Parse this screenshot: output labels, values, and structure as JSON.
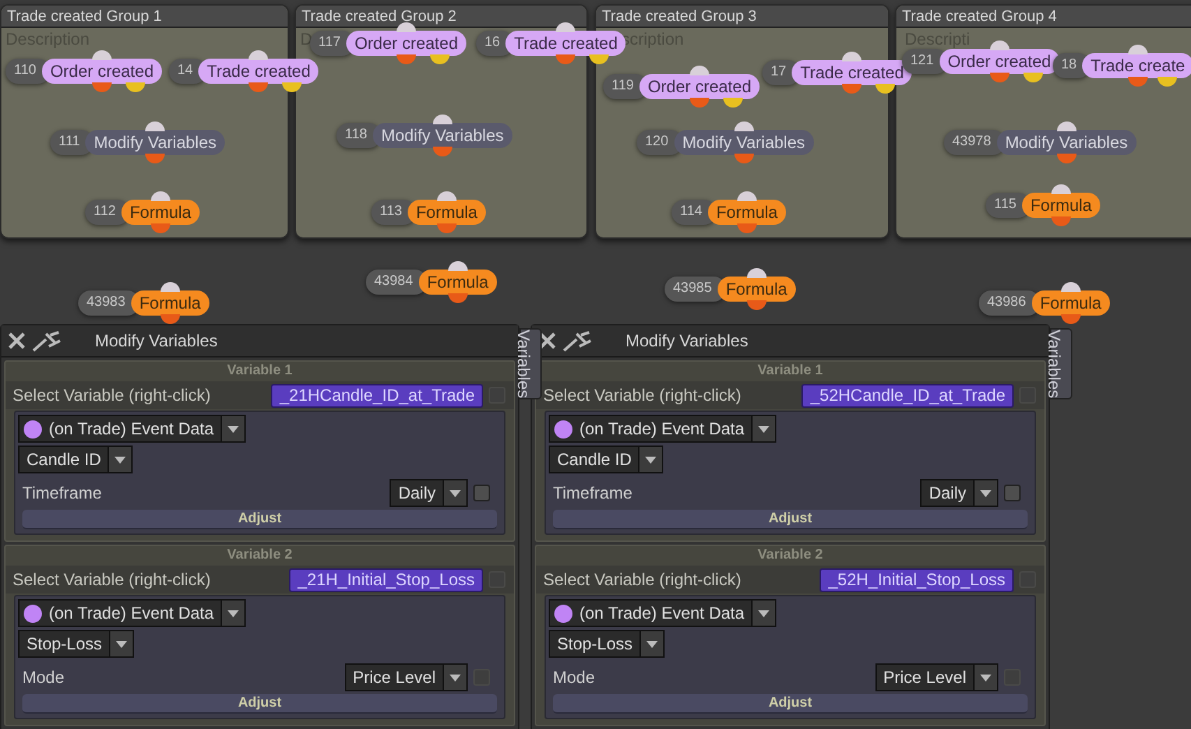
{
  "groups": [
    {
      "title": "Trade created Group 1",
      "description": "Description",
      "nodes": [
        {
          "kind": "event",
          "id": "110",
          "label": "Order created"
        },
        {
          "kind": "event",
          "id": "14",
          "label": "Trade created"
        },
        {
          "kind": "modify",
          "id": "111",
          "label": "Modify Variables"
        },
        {
          "kind": "formula",
          "id": "112",
          "label": "Formula"
        }
      ]
    },
    {
      "title": "Trade created Group 2",
      "description": "D",
      "nodes": [
        {
          "kind": "event",
          "id": "117",
          "label": "Order created"
        },
        {
          "kind": "event",
          "id": "16",
          "label": "Trade created"
        },
        {
          "kind": "modify",
          "id": "118",
          "label": "Modify Variables"
        },
        {
          "kind": "formula",
          "id": "113",
          "label": "Formula"
        }
      ]
    },
    {
      "title": "Trade created Group 3",
      "description": "scription",
      "nodes": [
        {
          "kind": "event",
          "id": "119",
          "label": "Order created"
        },
        {
          "kind": "event",
          "id": "17",
          "label": "Trade created"
        },
        {
          "kind": "modify",
          "id": "120",
          "label": "Modify Variables"
        },
        {
          "kind": "formula",
          "id": "114",
          "label": "Formula"
        }
      ]
    },
    {
      "title": "Trade created Group 4",
      "description": "Descripti",
      "nodes": [
        {
          "kind": "event",
          "id": "121",
          "label": "Order created"
        },
        {
          "kind": "event",
          "id": "18",
          "label": "Trade create"
        },
        {
          "kind": "modify",
          "id": "43978",
          "label": "Modify Variables"
        },
        {
          "kind": "formula",
          "id": "115",
          "label": "Formula"
        }
      ]
    }
  ],
  "outside_nodes": [
    {
      "kind": "formula",
      "id": "43983",
      "label": "Formula"
    },
    {
      "kind": "formula",
      "id": "43984",
      "label": "Formula"
    },
    {
      "kind": "formula",
      "id": "43985",
      "label": "Formula"
    },
    {
      "kind": "formula",
      "id": "43986",
      "label": "Formula"
    }
  ],
  "panels": [
    {
      "title": "Modify Variables",
      "side_tab": "Variables",
      "variables": [
        {
          "heading": "Variable 1",
          "select_label": "Select Variable (right-click)",
          "variable": "_21HCandle_ID_at_Trade",
          "select_checkbox": {
            "checked": false,
            "disabled": true
          },
          "source": "(on Trade) Event Data",
          "field": "Candle ID",
          "param_label": "Timeframe",
          "param_value": "Daily",
          "param_checkbox": {
            "checked": false,
            "disabled": false
          },
          "button": "Adjust"
        },
        {
          "heading": "Variable 2",
          "select_label": "Select Variable (right-click)",
          "variable": "_21H_Initial_Stop_Loss",
          "select_checkbox": {
            "checked": false,
            "disabled": true
          },
          "source": "(on Trade) Event Data",
          "field": "Stop-Loss",
          "param_label": "Mode",
          "param_value": "Price Level",
          "param_checkbox": {
            "checked": false,
            "disabled": true
          },
          "button": "Adjust"
        }
      ]
    },
    {
      "title": "Modify Variables",
      "side_tab": "Variables",
      "variables": [
        {
          "heading": "Variable 1",
          "select_label": "Select Variable (right-click)",
          "variable": "_52HCandle_ID_at_Trade",
          "select_checkbox": {
            "checked": false,
            "disabled": true
          },
          "source": "(on Trade) Event Data",
          "field": "Candle ID",
          "param_label": "Timeframe",
          "param_value": "Daily",
          "param_checkbox": {
            "checked": false,
            "disabled": false
          },
          "button": "Adjust"
        },
        {
          "heading": "Variable 2",
          "select_label": "Select Variable (right-click)",
          "variable": "_52H_Initial_Stop_Loss",
          "select_checkbox": {
            "checked": false,
            "disabled": true
          },
          "source": "(on Trade) Event Data",
          "field": "Stop-Loss",
          "param_label": "Mode",
          "param_value": "Price Level",
          "param_checkbox": {
            "checked": false,
            "disabled": true
          },
          "button": "Adjust"
        }
      ]
    }
  ]
}
